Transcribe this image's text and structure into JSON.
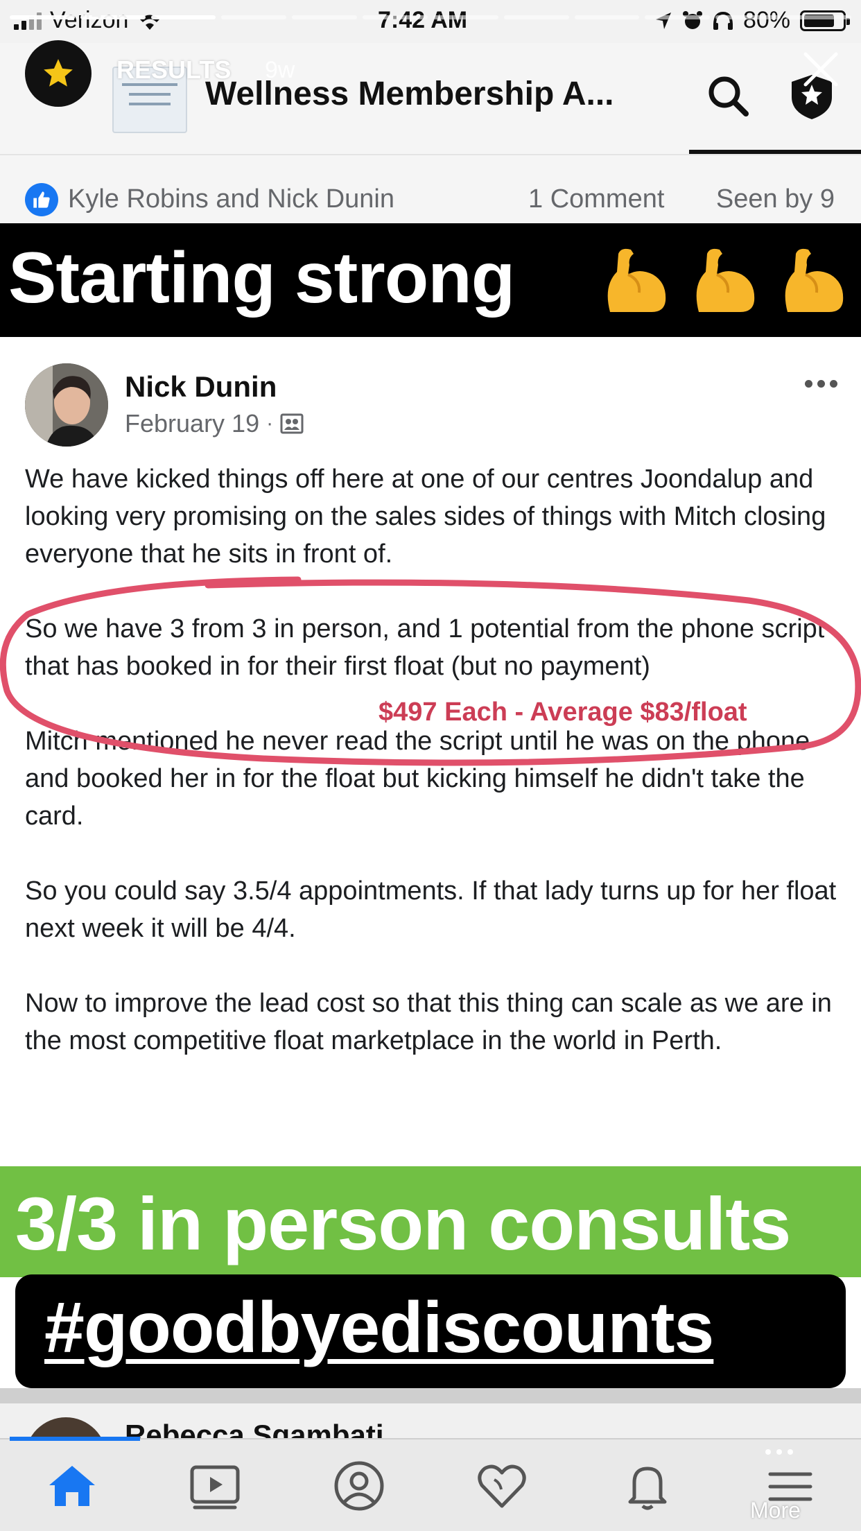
{
  "status_bar": {
    "carrier": "Verizon",
    "time": "7:42 AM",
    "battery": "80%"
  },
  "story": {
    "label": "RESULTS",
    "age": "9w"
  },
  "group": {
    "name": "Wellness Membership A..."
  },
  "reactions": {
    "names": "Kyle Robins and Nick Dunin",
    "comments": "1 Comment",
    "seen_by": "Seen by 9"
  },
  "banner_top": {
    "text": "Starting strong"
  },
  "post": {
    "author": "Nick Dunin",
    "date": "February 19",
    "dot": "·",
    "paragraphs": {
      "p1": "We have kicked things off here at one of our centres Joondalup and looking very promising on the sales sides of things with Mitch closing everyone that he sits in front of.",
      "p2": "So we have 3 from 3 in person, and 1 potential from the phone script that has booked in for their first float (but no payment)",
      "p3": "Mitch mentioned he never read the script until he was on the phone and booked her in for the float but kicking himself he didn't take the card.",
      "p4": "So you could say 3.5/4 appointments. If that lady turns up for her float next week it will be 4/4.",
      "p5": "Now to improve the lead cost so that this thing can scale as we are in the most competitive float marketplace in the world in Perth."
    },
    "annotation": "$497 Each - Average $83/float"
  },
  "banner_green": {
    "text": "3/3 in person consults"
  },
  "hashtag": {
    "text": "#goodbyediscounts"
  },
  "next_post": {
    "author": "Rebecca Sgambati"
  },
  "tabbar": {
    "more_label": "More"
  },
  "colors": {
    "facebook_blue": "#1877f2",
    "banner_green": "#71c044",
    "annotation_red": "#cc3d55"
  }
}
